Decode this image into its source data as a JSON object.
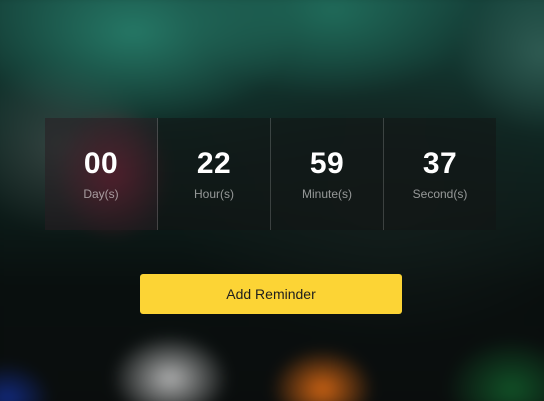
{
  "countdown": {
    "days": {
      "value": "00",
      "label": "Day(s)"
    },
    "hours": {
      "value": "22",
      "label": "Hour(s)"
    },
    "minutes": {
      "value": "59",
      "label": "Minute(s)"
    },
    "seconds": {
      "value": "37",
      "label": "Second(s)"
    }
  },
  "actions": {
    "reminder_label": "Add Reminder"
  },
  "colors": {
    "accent": "#fcd435",
    "text_primary": "#ffffff"
  }
}
